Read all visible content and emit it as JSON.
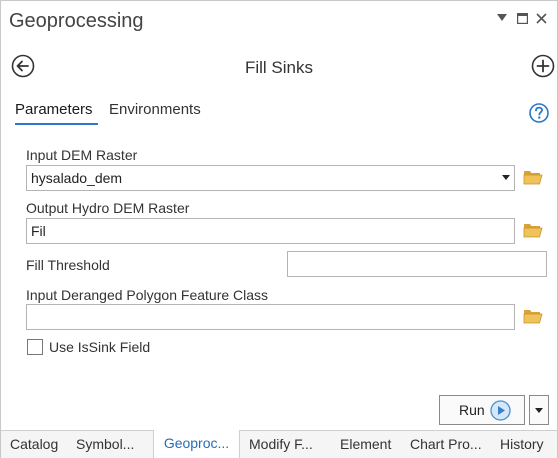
{
  "pane": {
    "title": "Geoprocessing",
    "controls": [
      "pin-icon",
      "restore-icon",
      "close-icon"
    ]
  },
  "tool": {
    "title": "Fill Sinks",
    "back_icon": "back-arrow-icon",
    "add_icon": "add-icon"
  },
  "tabs": {
    "parameters": "Parameters",
    "environments": "Environments",
    "help_icon": "help-icon"
  },
  "params": {
    "input_dem": {
      "label": "Input DEM Raster",
      "value": "hysalado_dem"
    },
    "output_dem": {
      "label": "Output Hydro DEM Raster",
      "value": "Fil"
    },
    "fill_threshold": {
      "label": "Fill Threshold",
      "value": ""
    },
    "deranged_polygon": {
      "label": "Input Deranged Polygon Feature Class",
      "value": ""
    },
    "use_issink": {
      "label": "Use IsSink Field",
      "checked": false
    }
  },
  "run": {
    "label": "Run",
    "icon": "play-icon"
  },
  "bottom_tabs": [
    {
      "label": "Catalog",
      "active": false
    },
    {
      "label": "Symbol...",
      "active": false
    },
    {
      "label": "Geoproc...",
      "active": true
    },
    {
      "label": "Modify F...",
      "active": false
    },
    {
      "label": "Element",
      "active": false
    },
    {
      "label": "Chart Pro...",
      "active": false
    },
    {
      "label": "History",
      "active": false
    }
  ],
  "colors": {
    "accent": "#2b77c9",
    "folder": "#e8b84a"
  }
}
